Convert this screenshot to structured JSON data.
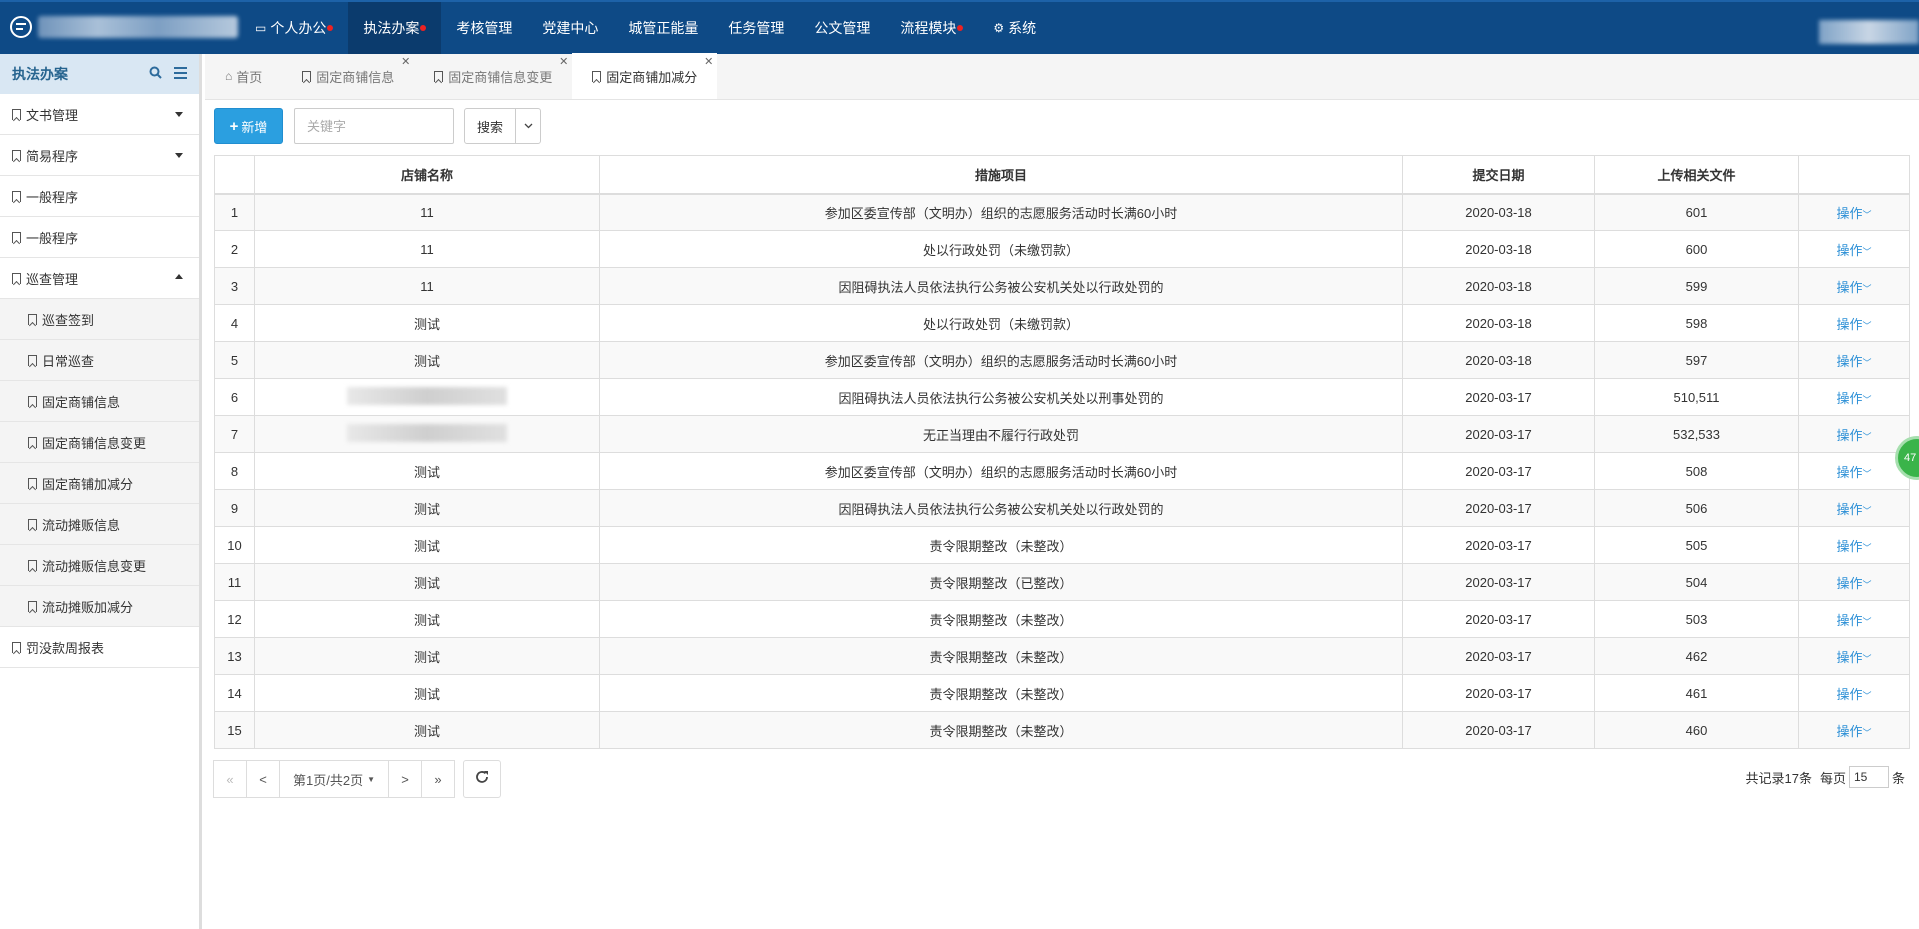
{
  "nav": {
    "items": [
      {
        "label": "个人办公",
        "icon": "monitor-icon",
        "dot": true
      },
      {
        "label": "执法办案",
        "dot": true,
        "active": true
      },
      {
        "label": "考核管理"
      },
      {
        "label": "党建中心"
      },
      {
        "label": "城管正能量"
      },
      {
        "label": "任务管理"
      },
      {
        "label": "公文管理"
      },
      {
        "label": "流程模块",
        "dot": true
      },
      {
        "label": "系统",
        "icon": "gear-icon"
      }
    ]
  },
  "sidebar": {
    "title": "执法办案",
    "items": [
      {
        "label": "文书管理"
      },
      {
        "label": "简易程序"
      },
      {
        "label": "一般程序"
      },
      {
        "label": "一般程序"
      },
      {
        "label": "巡查管理"
      },
      {
        "label": "巡查签到"
      },
      {
        "label": "日常巡查"
      },
      {
        "label": "固定商铺信息"
      },
      {
        "label": "固定商铺信息变更"
      },
      {
        "label": "固定商铺加减分"
      },
      {
        "label": "流动摊贩信息"
      },
      {
        "label": "流动摊贩信息变更"
      },
      {
        "label": "流动摊贩加减分"
      },
      {
        "label": "罚没款周报表"
      }
    ]
  },
  "tabs": [
    {
      "label": "首页"
    },
    {
      "label": "固定商铺信息"
    },
    {
      "label": "固定商铺信息变更"
    },
    {
      "label": "固定商铺加减分"
    }
  ],
  "toolbar": {
    "add_label": "新增",
    "search_placeholder": "关键字",
    "search_label": "搜索"
  },
  "table": {
    "headers": [
      "",
      "店铺名称",
      "措施项目",
      "提交日期",
      "上传相关文件",
      ""
    ],
    "op_label": "操作",
    "rows": [
      {
        "no": "1",
        "shop": "11",
        "item": "参加区委宣传部（文明办）组织的志愿服务活动时长满60小时",
        "date": "2020-03-18",
        "files": "601"
      },
      {
        "no": "2",
        "shop": "11",
        "item": "处以行政处罚（未缴罚款）",
        "date": "2020-03-18",
        "files": "600"
      },
      {
        "no": "3",
        "shop": "11",
        "item": "因阻碍执法人员依法执行公务被公安机关处以行政处罚的",
        "date": "2020-03-18",
        "files": "599"
      },
      {
        "no": "4",
        "shop": "测试",
        "item": "处以行政处罚（未缴罚款）",
        "date": "2020-03-18",
        "files": "598"
      },
      {
        "no": "5",
        "shop": "测试",
        "item": "参加区委宣传部（文明办）组织的志愿服务活动时长满60小时",
        "date": "2020-03-18",
        "files": "597"
      },
      {
        "no": "6",
        "shop": "",
        "item": "因阻碍执法人员依法执行公务被公安机关处以刑事处罚的",
        "date": "2020-03-17",
        "files": "510,511"
      },
      {
        "no": "7",
        "shop": "",
        "item": "无正当理由不履行行政处罚",
        "date": "2020-03-17",
        "files": "532,533"
      },
      {
        "no": "8",
        "shop": "测试",
        "item": "参加区委宣传部（文明办）组织的志愿服务活动时长满60小时",
        "date": "2020-03-17",
        "files": "508"
      },
      {
        "no": "9",
        "shop": "测试",
        "item": "因阻碍执法人员依法执行公务被公安机关处以行政处罚的",
        "date": "2020-03-17",
        "files": "506"
      },
      {
        "no": "10",
        "shop": "测试",
        "item": "责令限期整改（未整改）",
        "date": "2020-03-17",
        "files": "505"
      },
      {
        "no": "11",
        "shop": "测试",
        "item": "责令限期整改（已整改）",
        "date": "2020-03-17",
        "files": "504"
      },
      {
        "no": "12",
        "shop": "测试",
        "item": "责令限期整改（未整改）",
        "date": "2020-03-17",
        "files": "503"
      },
      {
        "no": "13",
        "shop": "测试",
        "item": "责令限期整改（未整改）",
        "date": "2020-03-17",
        "files": "462"
      },
      {
        "no": "14",
        "shop": "测试",
        "item": "责令限期整改（未整改）",
        "date": "2020-03-17",
        "files": "461"
      },
      {
        "no": "15",
        "shop": "测试",
        "item": "责令限期整改（未整改）",
        "date": "2020-03-17",
        "files": "460"
      }
    ]
  },
  "pager": {
    "first": "«",
    "prev": "<",
    "page_info": "第1页/共2页",
    "next": ">",
    "last": "»",
    "total": "共记录17条",
    "per_page_label": "每页",
    "per_page": "15",
    "unit": "条"
  },
  "badge": "47",
  "colors": {
    "nav_bg": "#0e4a86",
    "accent": "#2b9fe0",
    "link": "#2b8fd6",
    "badge": "#3ab44a"
  }
}
